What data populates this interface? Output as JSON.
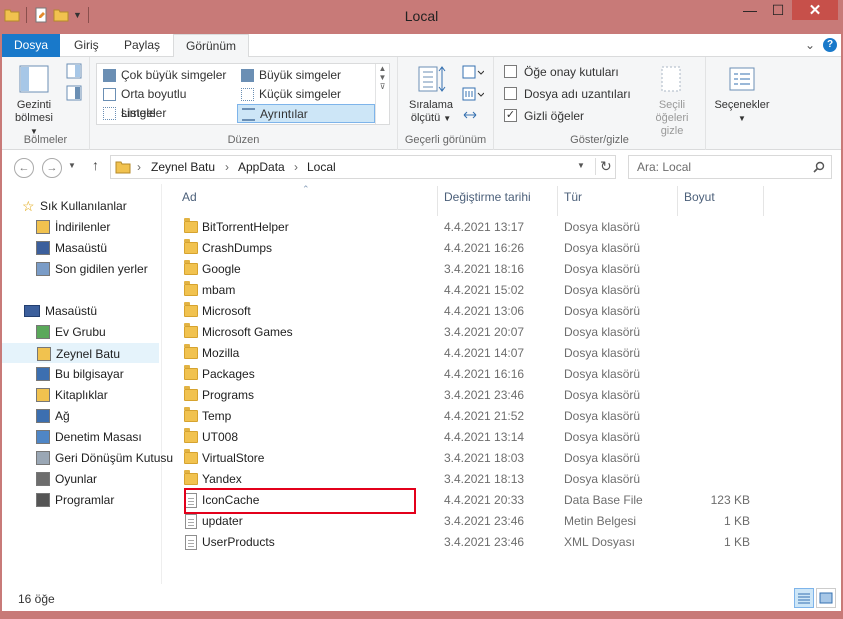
{
  "window": {
    "title": "Local"
  },
  "ribbon_tabs": {
    "file": "Dosya",
    "home": "Giriş",
    "share": "Paylaş",
    "view": "Görünüm"
  },
  "ribbon": {
    "panes": {
      "nav_pane_line1": "Gezinti",
      "nav_pane_line2": "bölmesi",
      "label": "Bölmeler"
    },
    "layout": {
      "items": [
        "Çok büyük simgeler",
        "Büyük simgeler",
        "Orta boyutlu simgeler",
        "Küçük simgeler",
        "Listele",
        "Ayrıntılar"
      ],
      "label": "Düzen"
    },
    "current_view": {
      "sort_line1": "Sıralama",
      "sort_line2": "ölçütü",
      "label": "Geçerli görünüm"
    },
    "show_hide": {
      "checkboxes": [
        {
          "label": "Öğe onay kutuları",
          "checked": false
        },
        {
          "label": "Dosya adı uzantıları",
          "checked": false
        },
        {
          "label": "Gizli öğeler",
          "checked": true
        }
      ],
      "hide_selected_line1": "Seçili öğeleri",
      "hide_selected_line2": "gizle",
      "label": "Göster/gizle"
    },
    "options": {
      "label": "Seçenekler"
    }
  },
  "address": {
    "crumbs": [
      "Zeynel Batu",
      "AppData",
      "Local"
    ],
    "search_placeholder": "Ara: Local"
  },
  "nav": {
    "favorites_header": "Sık Kullanılanlar",
    "favorites": [
      "İndirilenler",
      "Masaüstü",
      "Son gidilen yerler"
    ],
    "desktop_header": "Masaüstü",
    "desktop_items": [
      "Ev Grubu",
      "Zeynel Batu",
      "Bu bilgisayar",
      "Kitaplıklar",
      "Ağ",
      "Denetim Masası",
      "Geri Dönüşüm Kutusu",
      "Oyunlar",
      "Programlar"
    ],
    "selected": "Zeynel Batu"
  },
  "columns": {
    "name": "Ad",
    "date": "Değiştirme tarihi",
    "type": "Tür",
    "size": "Boyut"
  },
  "files": [
    {
      "name": "BitTorrentHelper",
      "date": "4.4.2021 13:17",
      "type": "Dosya klasörü",
      "size": "",
      "kind": "folder"
    },
    {
      "name": "CrashDumps",
      "date": "4.4.2021 16:26",
      "type": "Dosya klasörü",
      "size": "",
      "kind": "folder"
    },
    {
      "name": "Google",
      "date": "3.4.2021 18:16",
      "type": "Dosya klasörü",
      "size": "",
      "kind": "folder"
    },
    {
      "name": "mbam",
      "date": "4.4.2021 15:02",
      "type": "Dosya klasörü",
      "size": "",
      "kind": "folder"
    },
    {
      "name": "Microsoft",
      "date": "4.4.2021 13:06",
      "type": "Dosya klasörü",
      "size": "",
      "kind": "folder"
    },
    {
      "name": "Microsoft Games",
      "date": "3.4.2021 20:07",
      "type": "Dosya klasörü",
      "size": "",
      "kind": "folder"
    },
    {
      "name": "Mozilla",
      "date": "4.4.2021 14:07",
      "type": "Dosya klasörü",
      "size": "",
      "kind": "folder"
    },
    {
      "name": "Packages",
      "date": "4.4.2021 16:16",
      "type": "Dosya klasörü",
      "size": "",
      "kind": "folder"
    },
    {
      "name": "Programs",
      "date": "3.4.2021 23:46",
      "type": "Dosya klasörü",
      "size": "",
      "kind": "folder"
    },
    {
      "name": "Temp",
      "date": "4.4.2021 21:52",
      "type": "Dosya klasörü",
      "size": "",
      "kind": "folder"
    },
    {
      "name": "UT008",
      "date": "4.4.2021 13:14",
      "type": "Dosya klasörü",
      "size": "",
      "kind": "folder"
    },
    {
      "name": "VirtualStore",
      "date": "3.4.2021 18:03",
      "type": "Dosya klasörü",
      "size": "",
      "kind": "folder"
    },
    {
      "name": "Yandex",
      "date": "3.4.2021 18:13",
      "type": "Dosya klasörü",
      "size": "",
      "kind": "folder"
    },
    {
      "name": "IconCache",
      "date": "4.4.2021 20:33",
      "type": "Data Base File",
      "size": "123 KB",
      "kind": "file"
    },
    {
      "name": "updater",
      "date": "3.4.2021 23:46",
      "type": "Metin Belgesi",
      "size": "1 KB",
      "kind": "file"
    },
    {
      "name": "UserProducts",
      "date": "3.4.2021 23:46",
      "type": "XML Dosyası",
      "size": "1 KB",
      "kind": "file"
    }
  ],
  "status": {
    "count": "16 öğe"
  },
  "colors": {
    "titlebar": "#c87a78",
    "file_tab": "#1979ca",
    "highlight": "#e3001b",
    "close": "#c7504a"
  }
}
